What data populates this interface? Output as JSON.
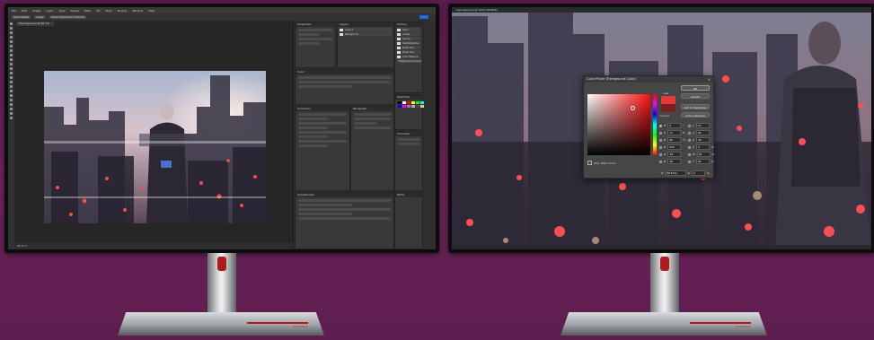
{
  "left_monitor": {
    "menu": [
      "File",
      "Edit",
      "Image",
      "Layer",
      "Type",
      "Select",
      "Filter",
      "3D",
      "View",
      "Plugins",
      "Window",
      "Help"
    ],
    "options_bar": [
      "Auto-Select",
      "Layer",
      "Show Transform Controls"
    ],
    "doc_tab": "cityscape.psd @ 66.7% (RGB/8)",
    "status": "66.67%",
    "panels": {
      "color": "Color",
      "swatches": "Swatches",
      "properties": "Properties",
      "adjustments": "Adjustments",
      "paragraph": "Paragraph",
      "history": "History",
      "layers": "Layers",
      "channels": "Channels",
      "paths": "Paths",
      "character": "Character"
    },
    "layers": [
      "Layer 1",
      "Background"
    ],
    "history_items": [
      "Open",
      "Levels",
      "Curves",
      "Hue/Saturation",
      "Brush Tool",
      "Brush Tool",
      "Color Balance",
      "Brightness/Contrast"
    ],
    "swatch_colors": [
      "#000000",
      "#ffffff",
      "#ff0000",
      "#ffff00",
      "#00ff00",
      "#00ffff",
      "#0000ff",
      "#ff00ff",
      "#888888",
      "#c8a2a8",
      "#5a3f4a",
      "#e8c8a0"
    ]
  },
  "right_monitor": {
    "title": "cityscape.psd @ 100% (RGB/8)",
    "dialog": {
      "title": "Color Picker (Foreground Color)",
      "new_label": "new",
      "current_label": "current",
      "ok": "OK",
      "cancel": "Cancel",
      "add_swatches": "Add to Swatches",
      "color_libraries": "Color Libraries",
      "only_web": "Only Web Colors",
      "hex_label": "#",
      "hex": "E63A3A",
      "fields": [
        {
          "label": "H",
          "value": "0",
          "unit": "°",
          "label2": "L",
          "value2": "53"
        },
        {
          "label": "S",
          "value": "75",
          "unit": "%",
          "label2": "a",
          "value2": "64"
        },
        {
          "label": "B",
          "value": "90",
          "unit": "%",
          "label2": "b",
          "value2": "40"
        },
        {
          "label": "R",
          "value": "230",
          "unit": "",
          "label2": "C",
          "value2": "6"
        },
        {
          "label": "G",
          "value": "58",
          "unit": "",
          "label2": "M",
          "value2": "93"
        },
        {
          "label": "B",
          "value": "58",
          "unit": "",
          "label2": "Y",
          "value2": "85"
        }
      ],
      "k_label": "K",
      "k_value": "0"
    }
  },
  "brand": "ThinkVision",
  "colors": {
    "accent_red": "#b01a1a",
    "ps_blue": "#1473e6",
    "picked": "#e63a3a"
  }
}
